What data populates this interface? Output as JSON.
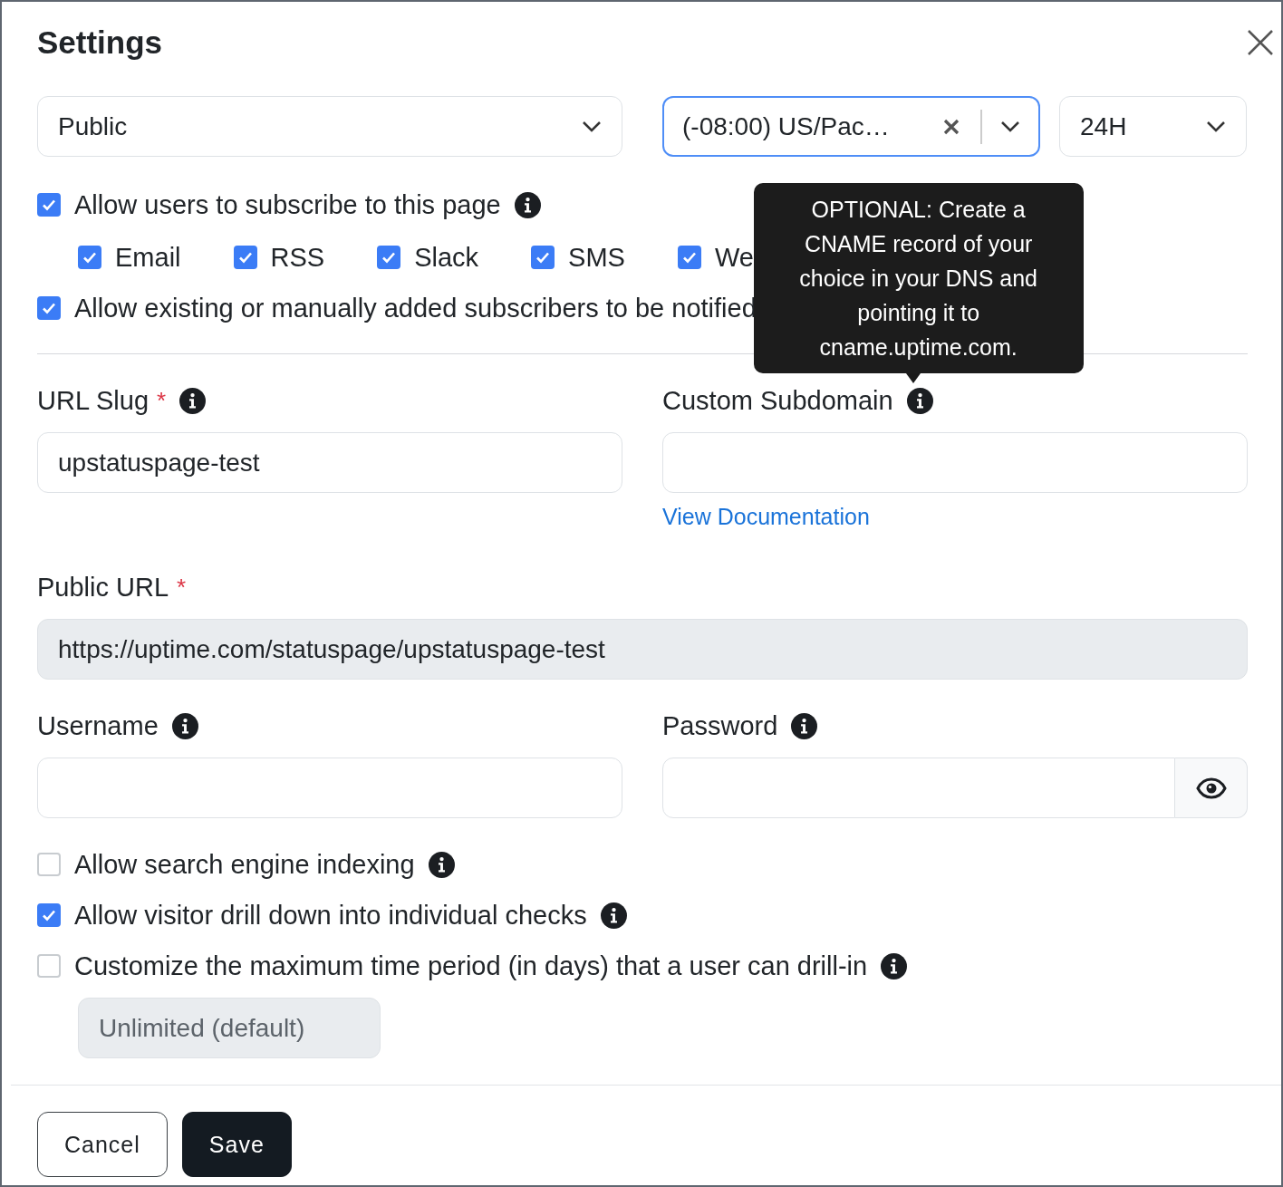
{
  "dialog": {
    "title": "Settings"
  },
  "visibility_select": {
    "value": "Public"
  },
  "timezone_select": {
    "value": "(-08:00) US/Pac…",
    "focused": true
  },
  "time_format_select": {
    "value": "24H"
  },
  "subscribe": {
    "label": "Allow users to subscribe to this page",
    "checked": true,
    "info": true
  },
  "channels": [
    {
      "label": "Email",
      "checked": true
    },
    {
      "label": "RSS",
      "checked": true
    },
    {
      "label": "Slack",
      "checked": true
    },
    {
      "label": "SMS",
      "checked": true
    },
    {
      "label": "We",
      "checked": true
    }
  ],
  "notify_existing": {
    "label": "Allow existing or manually added subscribers to be notified",
    "checked": true
  },
  "url_slug": {
    "label": "URL Slug",
    "required_mark": "*",
    "info": true,
    "value": "upstatuspage-test"
  },
  "custom_subdomain": {
    "label": "Custom Subdomain",
    "info": true,
    "link": "View Documentation",
    "tooltip": "OPTIONAL: Create a CNAME record of your choice in your DNS and pointing it to cname.uptime.com."
  },
  "public_url": {
    "label": "Public URL",
    "required_mark": "*",
    "value": "https://uptime.com/statuspage/upstatuspage-test",
    "readonly": true
  },
  "username": {
    "label": "Username",
    "info": true
  },
  "password": {
    "label": "Password",
    "info": true
  },
  "options": [
    {
      "label": "Allow search engine indexing",
      "checked": false,
      "info": true
    },
    {
      "label": "Allow visitor drill down into individual checks",
      "checked": true,
      "info": true
    },
    {
      "label": "Customize the maximum time period (in days) that a user can drill-in",
      "checked": false,
      "info": true
    }
  ],
  "drill_in_limit": {
    "value": "Unlimited (default)",
    "disabled": true
  },
  "buttons": [
    {
      "label": "Cancel",
      "kind": "secondary"
    },
    {
      "label": "Save",
      "kind": "primary"
    }
  ]
}
